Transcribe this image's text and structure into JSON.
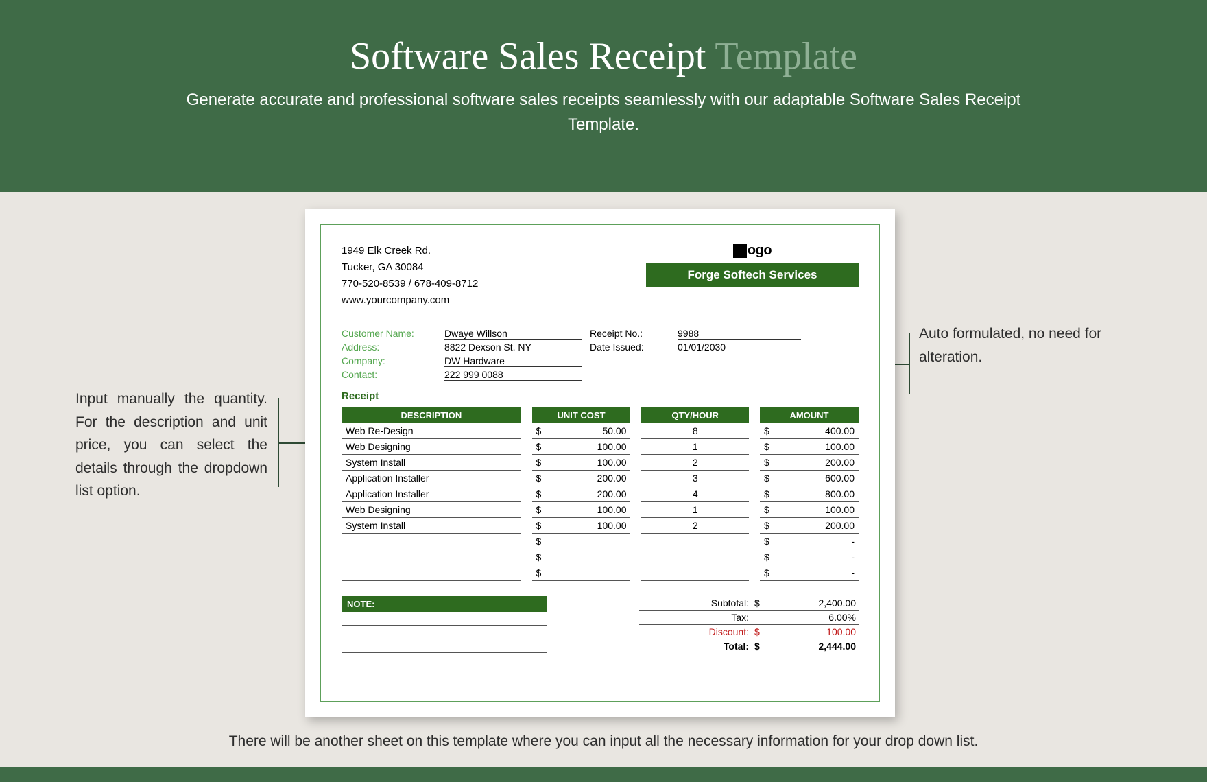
{
  "header": {
    "title_main": "Software Sales Receipt",
    "title_suffix": "Template",
    "subtitle": "Generate accurate and professional software sales receipts seamlessly with our adaptable Software Sales Receipt Template."
  },
  "callouts": {
    "left": "Input manually the quantity. For the description and unit price, you can select the details through the dropdown list option.",
    "right": "Auto formulated, no need for alteration.",
    "bottom": "There will be another sheet on this template where you can input all the necessary information for your drop down list."
  },
  "company": {
    "address_line1": "1949  Elk Creek Rd.",
    "address_line2": "Tucker, GA 30084",
    "phones": "770-520-8539 / 678-409-8712",
    "website": "www.yourcompany.com",
    "logo_text": "ogo",
    "name": "Forge Softech Services"
  },
  "labels": {
    "customer_name": "Customer Name:",
    "address": "Address:",
    "company": "Company:",
    "contact": "Contact:",
    "receipt_no": "Receipt No.:",
    "date_issued": "Date Issued:",
    "receipt": "Receipt",
    "note": "NOTE:",
    "subtotal": "Subtotal:",
    "tax": "Tax:",
    "discount": "Discount:",
    "total": "Total:"
  },
  "customer": {
    "name": "Dwaye Willson",
    "address": "8822 Dexson St. NY",
    "company": "DW Hardware",
    "contact": "222 999 0088"
  },
  "meta": {
    "receipt_no": "9988",
    "date_issued": "01/01/2030"
  },
  "cols": {
    "description": "DESCRIPTION",
    "unit_cost": "UNIT COST",
    "qty": "QTY/HOUR",
    "amount": "AMOUNT"
  },
  "currency": "$",
  "items": [
    {
      "desc": "Web Re-Design",
      "unit": "50.00",
      "qty": "8",
      "amount": "400.00"
    },
    {
      "desc": "Web Designing",
      "unit": "100.00",
      "qty": "1",
      "amount": "100.00"
    },
    {
      "desc": "System Install",
      "unit": "100.00",
      "qty": "2",
      "amount": "200.00"
    },
    {
      "desc": "Application Installer",
      "unit": "200.00",
      "qty": "3",
      "amount": "600.00"
    },
    {
      "desc": "Application Installer",
      "unit": "200.00",
      "qty": "4",
      "amount": "800.00"
    },
    {
      "desc": "Web Designing",
      "unit": "100.00",
      "qty": "1",
      "amount": "100.00"
    },
    {
      "desc": "System Install",
      "unit": "100.00",
      "qty": "2",
      "amount": "200.00"
    },
    {
      "desc": "",
      "unit": "",
      "qty": "",
      "amount": "-"
    },
    {
      "desc": "",
      "unit": "",
      "qty": "",
      "amount": "-"
    },
    {
      "desc": "",
      "unit": "",
      "qty": "",
      "amount": "-"
    }
  ],
  "totals": {
    "subtotal": "2,400.00",
    "tax": "6.00%",
    "discount": "100.00",
    "total": "2,444.00"
  }
}
